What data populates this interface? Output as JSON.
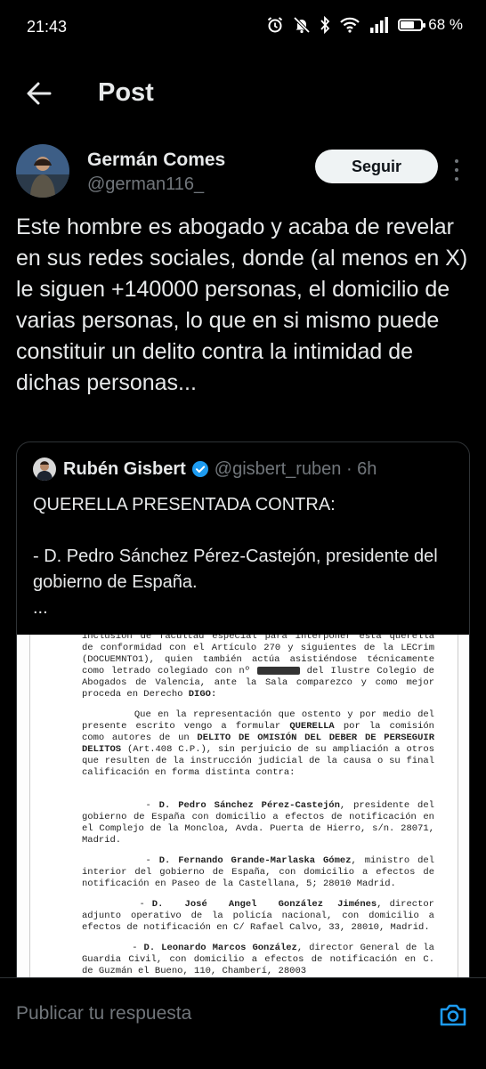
{
  "status_bar": {
    "time": "21:43",
    "battery": "68 %",
    "battery_level": 0.68
  },
  "header": {
    "title": "Post"
  },
  "post": {
    "author_name": "Germán Comes",
    "author_handle": "@german116_",
    "follow_label": "Seguir",
    "text": "Este hombre es abogado y acaba de revelar en sus redes sociales, donde (al menos en X) le siguen +140000 personas, el domicilio de varias personas, lo que en si mismo puede constituir un delito contra la intimidad de dichas personas..."
  },
  "quote": {
    "author_name": "Rubén Gisbert",
    "author_handle": "@gisbert_ruben · 6h",
    "text": "QUERELLA PRESENTADA CONTRA:\n\n- D. Pedro Sánchez Pérez-Castejón, presidente del gobierno de España.\n...",
    "document": {
      "p1a": "inclusión de facultad especial para interponer esta querella de conformidad con el Artículo 270 y siguientes de la LECrim (DOCUEMNTO1), quien también actúa asistiéndose técnicamente como letrado colegiado con nº",
      "p1b": " del Ilustre Colegio de Abogados de Valencia, ante la Sala comparezco y como mejor proceda en Derecho ",
      "p1c": "DIGO:",
      "p2a": "        Que en la representación que ostento y por medio del presente escrito vengo a formular ",
      "p2b": "QUERELLA",
      "p2c": " por la comisión como autores de un ",
      "p2d": "DELITO DE OMISIÓN DEL DEBER DE PERSEGUIR DELITOS",
      "p2e": " (Art.408 C.P.), sin perjuicio de su ampliación a otros que resulten de la instrucción judicial de la causa o su final calificación en forma distinta contra:",
      "items": [
        {
          "lead": "        - ",
          "bold": "D. Pedro Sánchez Pérez-Castejón",
          "rest": ", presidente del gobierno de España con domicilio a efectos de notificación en el Complejo de la Moncloa, Avda. Puerta de Hierro, s/n. 28071, Madrid."
        },
        {
          "lead": "        - ",
          "bold": "D. Fernando Grande-Marlaska Gómez",
          "rest": ", ministro del interior del gobierno de España, con domicilio a efectos de notificación en Paseo de la Castellana, 5; 28010 Madrid."
        },
        {
          "lead": "        - ",
          "bold": "D.   José   Angel   González  Jiménes",
          "rest": ", director adjunto operativo de la policía nacional, con domicilio a efectos de notificación en C/ Rafael Calvo, 33, 28010, Madrid."
        },
        {
          "lead": "        - ",
          "bold": "D. Leonardo Marcos González",
          "rest": ", director General de la Guardia Civil, con domicilio a efectos de notificación en C. de Guzmán el Bueno, 110, Chamberí, 28003"
        }
      ]
    }
  },
  "reply": {
    "placeholder": "Publicar tu respuesta"
  },
  "icons": {
    "back": "arrow-left-icon",
    "more": "more-vertical-icon",
    "verified": "verified-badge-icon",
    "camera": "camera-icon"
  },
  "colors": {
    "background": "#000000",
    "text": "#e7e9ea",
    "secondary": "#71767b",
    "accent": "#1d9bf0",
    "border": "#2f3336"
  }
}
